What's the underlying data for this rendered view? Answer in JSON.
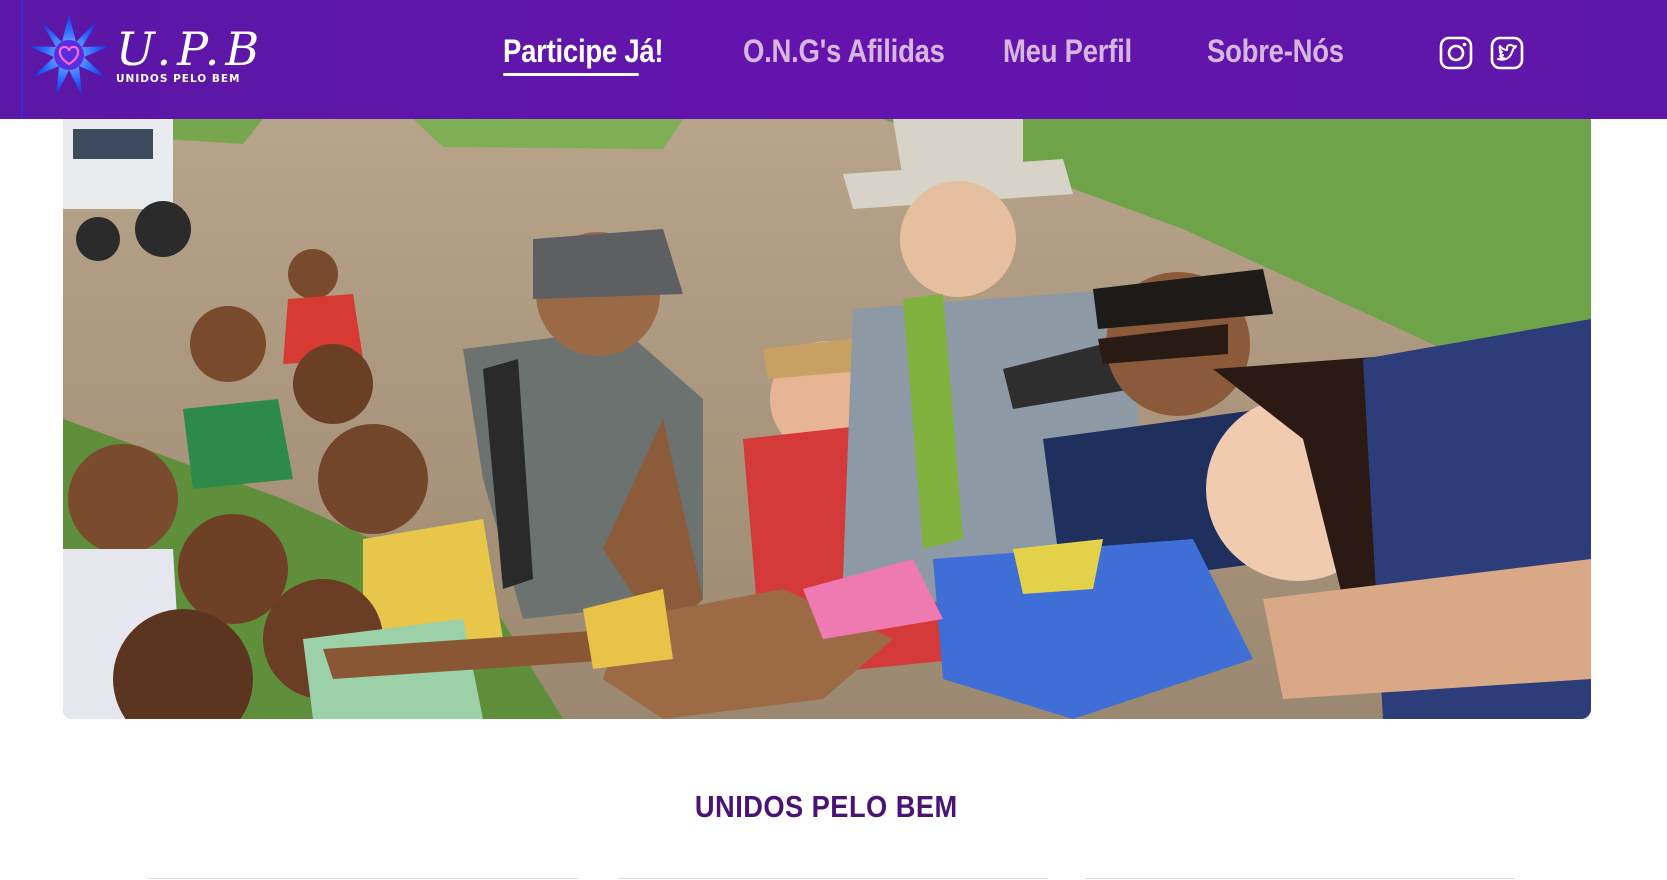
{
  "brand": {
    "title": "U.P.B",
    "subtitle": "UNIDOS PELO BEM"
  },
  "nav": {
    "items": [
      {
        "label": "Participe Já!",
        "active": true
      },
      {
        "label": "O.N.G's Afilidas",
        "active": false
      },
      {
        "label": "Meu Perfil",
        "active": false
      },
      {
        "label": "Sobre-Nós",
        "active": false
      }
    ],
    "social": [
      "instagram-icon",
      "twitter-icon"
    ]
  },
  "hero": {
    "image": "group-of-volunteers-and-children-stacking-hands-photo"
  },
  "main": {
    "headline": "UNIDOS PELO BEM"
  },
  "colors": {
    "header": "#6414ad",
    "nav_inactive": "#d7b6df",
    "headline": "#4a1475"
  }
}
